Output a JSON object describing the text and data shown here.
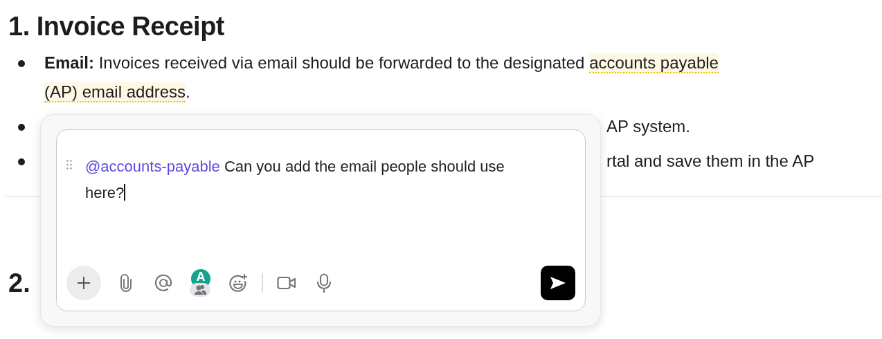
{
  "document": {
    "heading": "1. Invoice Receipt",
    "bullets": [
      {
        "kind": "full",
        "text": "**Email:** Invoices received via email should be forwarded to the designated ",
        "highlight": [
          "accounts payable",
          "(AP) email address"
        ],
        "tail": "."
      },
      {
        "kind": "covered",
        "text": "AP system."
      },
      {
        "kind": "covered",
        "text": "rtal and save them in the AP"
      }
    ],
    "heading_2": "2."
  },
  "comment_box": {
    "mention": "@accounts-payable",
    "text": " Can you add the email people should use here?",
    "avatar_initial": "A"
  }
}
